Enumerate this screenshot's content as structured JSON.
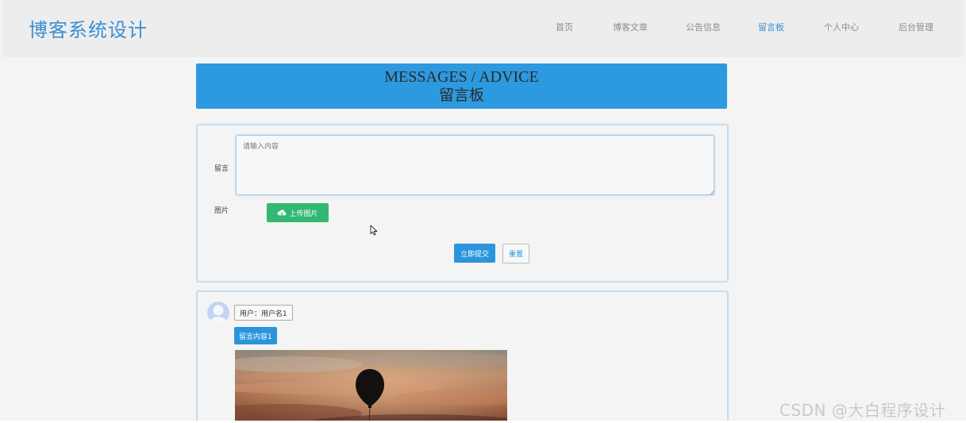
{
  "header": {
    "site_title": "博客系统设计",
    "nav": [
      {
        "label": "首页"
      },
      {
        "label": "博客文章"
      },
      {
        "label": "公告信息"
      },
      {
        "label": "留言板"
      },
      {
        "label": "个人中心"
      },
      {
        "label": "后台管理"
      }
    ],
    "active_nav": "留言板"
  },
  "banner": {
    "title_en": "MESSAGES / ADVICE",
    "title_cn": "留言板"
  },
  "form": {
    "message_label": "留言",
    "message_placeholder": "请输入内容",
    "message_value": "",
    "image_label": "图片",
    "upload_label": "上传图片",
    "submit_label": "立即提交",
    "reset_label": "重置"
  },
  "messages": [
    {
      "user": "用户：用户名1",
      "content": "留言内容1"
    }
  ],
  "watermark": "CSDN @大白程序设计",
  "colors": {
    "accent": "#2d99df",
    "title_blue": "#3a8fd1",
    "upload_green": "#31b873",
    "header_bg": "#eeedee",
    "page_bg": "#f4f4f4",
    "card_border": "#c6dbf0"
  },
  "icons": {
    "upload": "cloud-upload-icon",
    "avatar": "user-avatar-icon",
    "cursor": "mouse-pointer-icon"
  }
}
